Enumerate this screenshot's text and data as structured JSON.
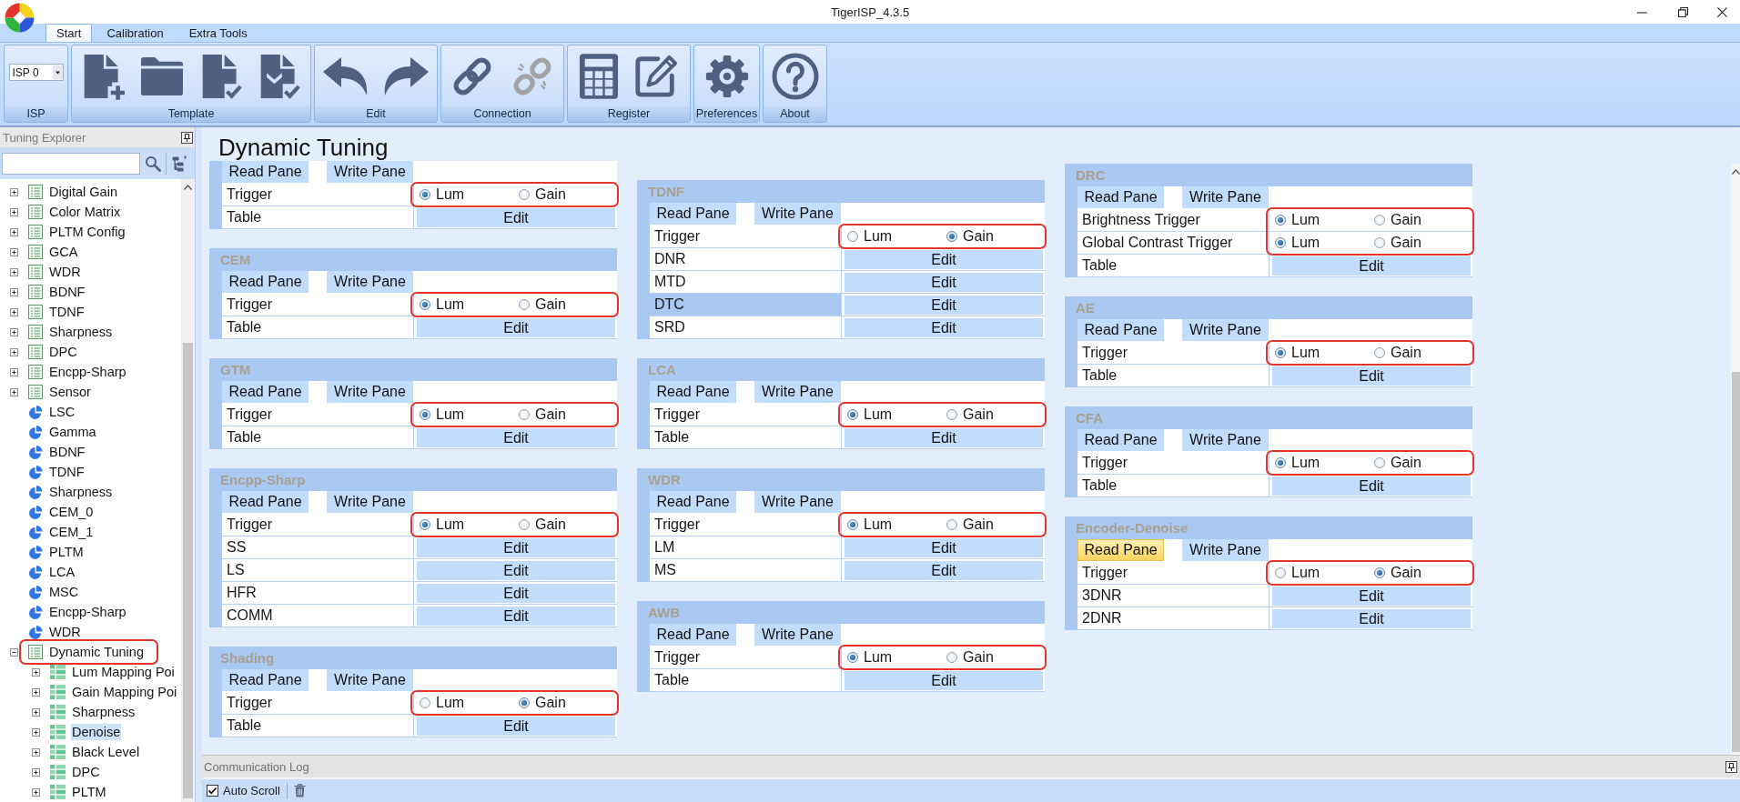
{
  "window": {
    "title": "TigerISP_4.3.5"
  },
  "tabs": [
    {
      "label": "Start",
      "selected": true
    },
    {
      "label": "Calibration",
      "selected": false
    },
    {
      "label": "Extra Tools",
      "selected": false
    }
  ],
  "ribbon": {
    "groups": [
      {
        "kind": "select",
        "label": "ISP",
        "value": "ISP 0"
      },
      {
        "kind": "icons",
        "label": "Template",
        "buttons": [
          {
            "disabled": false
          },
          {
            "disabled": false
          },
          {
            "disabled": false
          },
          {
            "disabled": false
          }
        ]
      },
      {
        "kind": "icons",
        "label": "Edit",
        "buttons": [
          {
            "disabled": false
          },
          {
            "disabled": false
          }
        ]
      },
      {
        "kind": "icons",
        "label": "Connection",
        "buttons": [
          {
            "disabled": false
          },
          {
            "disabled": true
          }
        ]
      },
      {
        "kind": "icons",
        "label": "Register",
        "buttons": [
          {
            "disabled": false
          },
          {
            "disabled": false
          }
        ]
      },
      {
        "kind": "icons",
        "label": "Preferences",
        "buttons": [
          {
            "disabled": false
          }
        ]
      },
      {
        "kind": "icons",
        "label": "About",
        "buttons": [
          {
            "disabled": false
          }
        ]
      }
    ]
  },
  "sidebar": {
    "title": "Tuning Explorer",
    "tree": [
      {
        "label": "Digital Gain",
        "kind": "list",
        "expanded": false,
        "selected": false,
        "annotated": false
      },
      {
        "label": "Color Matrix",
        "kind": "list",
        "expanded": false,
        "selected": false,
        "annotated": false
      },
      {
        "label": "PLTM Config",
        "kind": "list",
        "expanded": false,
        "selected": false,
        "annotated": false
      },
      {
        "label": "GCA",
        "kind": "list",
        "expanded": false,
        "selected": false,
        "annotated": false
      },
      {
        "label": "WDR",
        "kind": "list",
        "expanded": false,
        "selected": false,
        "annotated": false
      },
      {
        "label": "BDNF",
        "kind": "list",
        "expanded": false,
        "selected": false,
        "annotated": false
      },
      {
        "label": "TDNF",
        "kind": "list",
        "expanded": false,
        "selected": false,
        "annotated": false
      },
      {
        "label": "Sharpness",
        "kind": "list",
        "expanded": false,
        "selected": false,
        "annotated": false
      },
      {
        "label": "DPC",
        "kind": "list",
        "expanded": false,
        "selected": false,
        "annotated": false
      },
      {
        "label": "Encpp-Sharp",
        "kind": "list",
        "expanded": false,
        "selected": false,
        "annotated": false
      },
      {
        "label": "Sensor",
        "kind": "list",
        "expanded": false,
        "selected": false,
        "annotated": false
      },
      {
        "label": "LSC",
        "kind": "pie",
        "selected": false,
        "annotated": false
      },
      {
        "label": "Gamma",
        "kind": "pie",
        "selected": false,
        "annotated": false
      },
      {
        "label": "BDNF",
        "kind": "pie",
        "selected": false,
        "annotated": false
      },
      {
        "label": "TDNF",
        "kind": "pie",
        "selected": false,
        "annotated": false
      },
      {
        "label": "Sharpness",
        "kind": "pie",
        "selected": false,
        "annotated": false
      },
      {
        "label": "CEM_0",
        "kind": "pie",
        "selected": false,
        "annotated": false
      },
      {
        "label": "CEM_1",
        "kind": "pie",
        "selected": false,
        "annotated": false
      },
      {
        "label": "PLTM",
        "kind": "pie",
        "selected": false,
        "annotated": false
      },
      {
        "label": "LCA",
        "kind": "pie",
        "selected": false,
        "annotated": false
      },
      {
        "label": "MSC",
        "kind": "pie",
        "selected": false,
        "annotated": false
      },
      {
        "label": "Encpp-Sharp",
        "kind": "pie",
        "selected": false,
        "annotated": false
      },
      {
        "label": "WDR",
        "kind": "pie",
        "selected": false,
        "annotated": false
      },
      {
        "label": "Dynamic Tuning",
        "kind": "list",
        "expanded": true,
        "selected": false,
        "annotated": true,
        "children": [
          {
            "label": "Lum Mapping Poi",
            "kind": "grid",
            "expanded": false,
            "selected": false,
            "annotated": false
          },
          {
            "label": "Gain Mapping Poi",
            "kind": "grid",
            "expanded": false,
            "selected": false,
            "annotated": false
          },
          {
            "label": "Sharpness",
            "kind": "grid",
            "expanded": false,
            "selected": false,
            "annotated": false
          },
          {
            "label": "Denoise",
            "kind": "grid",
            "expanded": false,
            "selected": true,
            "annotated": false
          },
          {
            "label": "Black Level",
            "kind": "grid",
            "expanded": false,
            "selected": false,
            "annotated": false
          },
          {
            "label": "DPC",
            "kind": "grid",
            "expanded": false,
            "selected": false,
            "annotated": false
          },
          {
            "label": "PLTM",
            "kind": "grid",
            "expanded": false,
            "selected": false,
            "annotated": false
          }
        ]
      }
    ]
  },
  "main": {
    "title": "Dynamic Tuning",
    "columns": [
      {
        "panels": [
          {
            "annotated": true,
            "panes": [
              {
                "label": "Read Pane",
                "hovered": false
              },
              {
                "label": "Write Pane",
                "hovered": false
              }
            ],
            "rows": [
              {
                "kind": "trigger",
                "label": "Trigger",
                "options": [
                  {
                    "label": "Lum",
                    "selected": true
                  },
                  {
                    "label": "Gain",
                    "selected": false
                  }
                ]
              },
              {
                "kind": "edit",
                "label": "Table",
                "button": "Edit",
                "selected": false
              }
            ]
          },
          {
            "title": "CEM",
            "annotated": true,
            "panes": [
              {
                "label": "Read Pane",
                "hovered": false
              },
              {
                "label": "Write Pane",
                "hovered": false
              }
            ],
            "rows": [
              {
                "kind": "trigger",
                "label": "Trigger",
                "options": [
                  {
                    "label": "Lum",
                    "selected": true
                  },
                  {
                    "label": "Gain",
                    "selected": false
                  }
                ]
              },
              {
                "kind": "edit",
                "label": "Table",
                "button": "Edit",
                "selected": false
              }
            ]
          },
          {
            "title": "GTM",
            "annotated": true,
            "panes": [
              {
                "label": "Read Pane",
                "hovered": false
              },
              {
                "label": "Write Pane",
                "hovered": false
              }
            ],
            "rows": [
              {
                "kind": "trigger",
                "label": "Trigger",
                "options": [
                  {
                    "label": "Lum",
                    "selected": true
                  },
                  {
                    "label": "Gain",
                    "selected": false
                  }
                ]
              },
              {
                "kind": "edit",
                "label": "Table",
                "button": "Edit",
                "selected": false
              }
            ]
          },
          {
            "title": "Encpp-Sharp",
            "annotated": true,
            "panes": [
              {
                "label": "Read Pane",
                "hovered": false
              },
              {
                "label": "Write Pane",
                "hovered": false
              }
            ],
            "rows": [
              {
                "kind": "trigger",
                "label": "Trigger",
                "options": [
                  {
                    "label": "Lum",
                    "selected": true
                  },
                  {
                    "label": "Gain",
                    "selected": false
                  }
                ]
              },
              {
                "kind": "edit",
                "label": "SS",
                "button": "Edit",
                "selected": false
              },
              {
                "kind": "edit",
                "label": "LS",
                "button": "Edit",
                "selected": false
              },
              {
                "kind": "edit",
                "label": "HFR",
                "button": "Edit",
                "selected": false
              },
              {
                "kind": "edit",
                "label": "COMM",
                "button": "Edit",
                "selected": false
              }
            ]
          },
          {
            "title": "Shading",
            "annotated": true,
            "panes": [
              {
                "label": "Read Pane",
                "hovered": false
              },
              {
                "label": "Write Pane",
                "hovered": false
              }
            ],
            "rows": [
              {
                "kind": "trigger",
                "label": "Trigger",
                "options": [
                  {
                    "label": "Lum",
                    "selected": false
                  },
                  {
                    "label": "Gain",
                    "selected": true
                  }
                ]
              },
              {
                "kind": "edit",
                "label": "Table",
                "button": "Edit",
                "selected": false
              }
            ]
          }
        ]
      },
      {
        "panels": [
          {
            "title": "TDNF",
            "annotated": true,
            "panes": [
              {
                "label": "Read Pane",
                "hovered": false
              },
              {
                "label": "Write Pane",
                "hovered": false
              }
            ],
            "rows": [
              {
                "kind": "trigger",
                "label": "Trigger",
                "options": [
                  {
                    "label": "Lum",
                    "selected": false
                  },
                  {
                    "label": "Gain",
                    "selected": true
                  }
                ]
              },
              {
                "kind": "edit",
                "label": "DNR",
                "button": "Edit",
                "selected": false
              },
              {
                "kind": "edit",
                "label": "MTD",
                "button": "Edit",
                "selected": false
              },
              {
                "kind": "edit",
                "label": "DTC",
                "button": "Edit",
                "selected": true
              },
              {
                "kind": "edit",
                "label": "SRD",
                "button": "Edit",
                "selected": false
              }
            ]
          },
          {
            "title": "LCA",
            "annotated": true,
            "panes": [
              {
                "label": "Read Pane",
                "hovered": false
              },
              {
                "label": "Write Pane",
                "hovered": false
              }
            ],
            "rows": [
              {
                "kind": "trigger",
                "label": "Trigger",
                "options": [
                  {
                    "label": "Lum",
                    "selected": true
                  },
                  {
                    "label": "Gain",
                    "selected": false
                  }
                ]
              },
              {
                "kind": "edit",
                "label": "Table",
                "button": "Edit",
                "selected": false
              }
            ]
          },
          {
            "title": "WDR",
            "annotated": true,
            "panes": [
              {
                "label": "Read Pane",
                "hovered": false
              },
              {
                "label": "Write Pane",
                "hovered": false
              }
            ],
            "rows": [
              {
                "kind": "trigger",
                "label": "Trigger",
                "options": [
                  {
                    "label": "Lum",
                    "selected": true
                  },
                  {
                    "label": "Gain",
                    "selected": false
                  }
                ]
              },
              {
                "kind": "edit",
                "label": "LM",
                "button": "Edit",
                "selected": false
              },
              {
                "kind": "edit",
                "label": "MS",
                "button": "Edit",
                "selected": false
              }
            ]
          },
          {
            "title": "AWB",
            "annotated": true,
            "panes": [
              {
                "label": "Read Pane",
                "hovered": false
              },
              {
                "label": "Write Pane",
                "hovered": false
              }
            ],
            "rows": [
              {
                "kind": "trigger",
                "label": "Trigger",
                "options": [
                  {
                    "label": "Lum",
                    "selected": true
                  },
                  {
                    "label": "Gain",
                    "selected": false
                  }
                ]
              },
              {
                "kind": "edit",
                "label": "Table",
                "button": "Edit",
                "selected": false
              }
            ]
          }
        ]
      },
      {
        "panels": [
          {
            "title": "DRC",
            "annotated": true,
            "panes": [
              {
                "label": "Read Pane",
                "hovered": false
              },
              {
                "label": "Write Pane",
                "hovered": false
              }
            ],
            "rows": [
              {
                "kind": "trigger",
                "label": "Brightness Trigger",
                "options": [
                  {
                    "label": "Lum",
                    "selected": true
                  },
                  {
                    "label": "Gain",
                    "selected": false
                  }
                ]
              },
              {
                "kind": "trigger",
                "label": "Global Contrast Trigger",
                "options": [
                  {
                    "label": "Lum",
                    "selected": true
                  },
                  {
                    "label": "Gain",
                    "selected": false
                  }
                ]
              },
              {
                "kind": "edit",
                "label": "Table",
                "button": "Edit",
                "selected": false
              }
            ]
          },
          {
            "title": "AE",
            "annotated": true,
            "panes": [
              {
                "label": "Read Pane",
                "hovered": false
              },
              {
                "label": "Write Pane",
                "hovered": false
              }
            ],
            "rows": [
              {
                "kind": "trigger",
                "label": "Trigger",
                "options": [
                  {
                    "label": "Lum",
                    "selected": true
                  },
                  {
                    "label": "Gain",
                    "selected": false
                  }
                ]
              },
              {
                "kind": "edit",
                "label": "Table",
                "button": "Edit",
                "selected": false
              }
            ]
          },
          {
            "title": "CFA",
            "annotated": true,
            "panes": [
              {
                "label": "Read Pane",
                "hovered": false
              },
              {
                "label": "Write Pane",
                "hovered": false
              }
            ],
            "rows": [
              {
                "kind": "trigger",
                "label": "Trigger",
                "options": [
                  {
                    "label": "Lum",
                    "selected": true
                  },
                  {
                    "label": "Gain",
                    "selected": false
                  }
                ]
              },
              {
                "kind": "edit",
                "label": "Table",
                "button": "Edit",
                "selected": false
              }
            ]
          },
          {
            "title": "Encoder-Denoise",
            "annotated": true,
            "panes": [
              {
                "label": "Read Pane",
                "hovered": true
              },
              {
                "label": "Write Pane",
                "hovered": false
              }
            ],
            "rows": [
              {
                "kind": "trigger",
                "label": "Trigger",
                "options": [
                  {
                    "label": "Lum",
                    "selected": false
                  },
                  {
                    "label": "Gain",
                    "selected": true
                  }
                ]
              },
              {
                "kind": "edit",
                "label": "3DNR",
                "button": "Edit",
                "selected": false
              },
              {
                "kind": "edit",
                "label": "2DNR",
                "button": "Edit",
                "selected": false
              }
            ]
          }
        ]
      }
    ]
  },
  "log": {
    "title": "Communication Log",
    "auto_scroll": {
      "label": "Auto Scroll",
      "checked": true
    }
  }
}
